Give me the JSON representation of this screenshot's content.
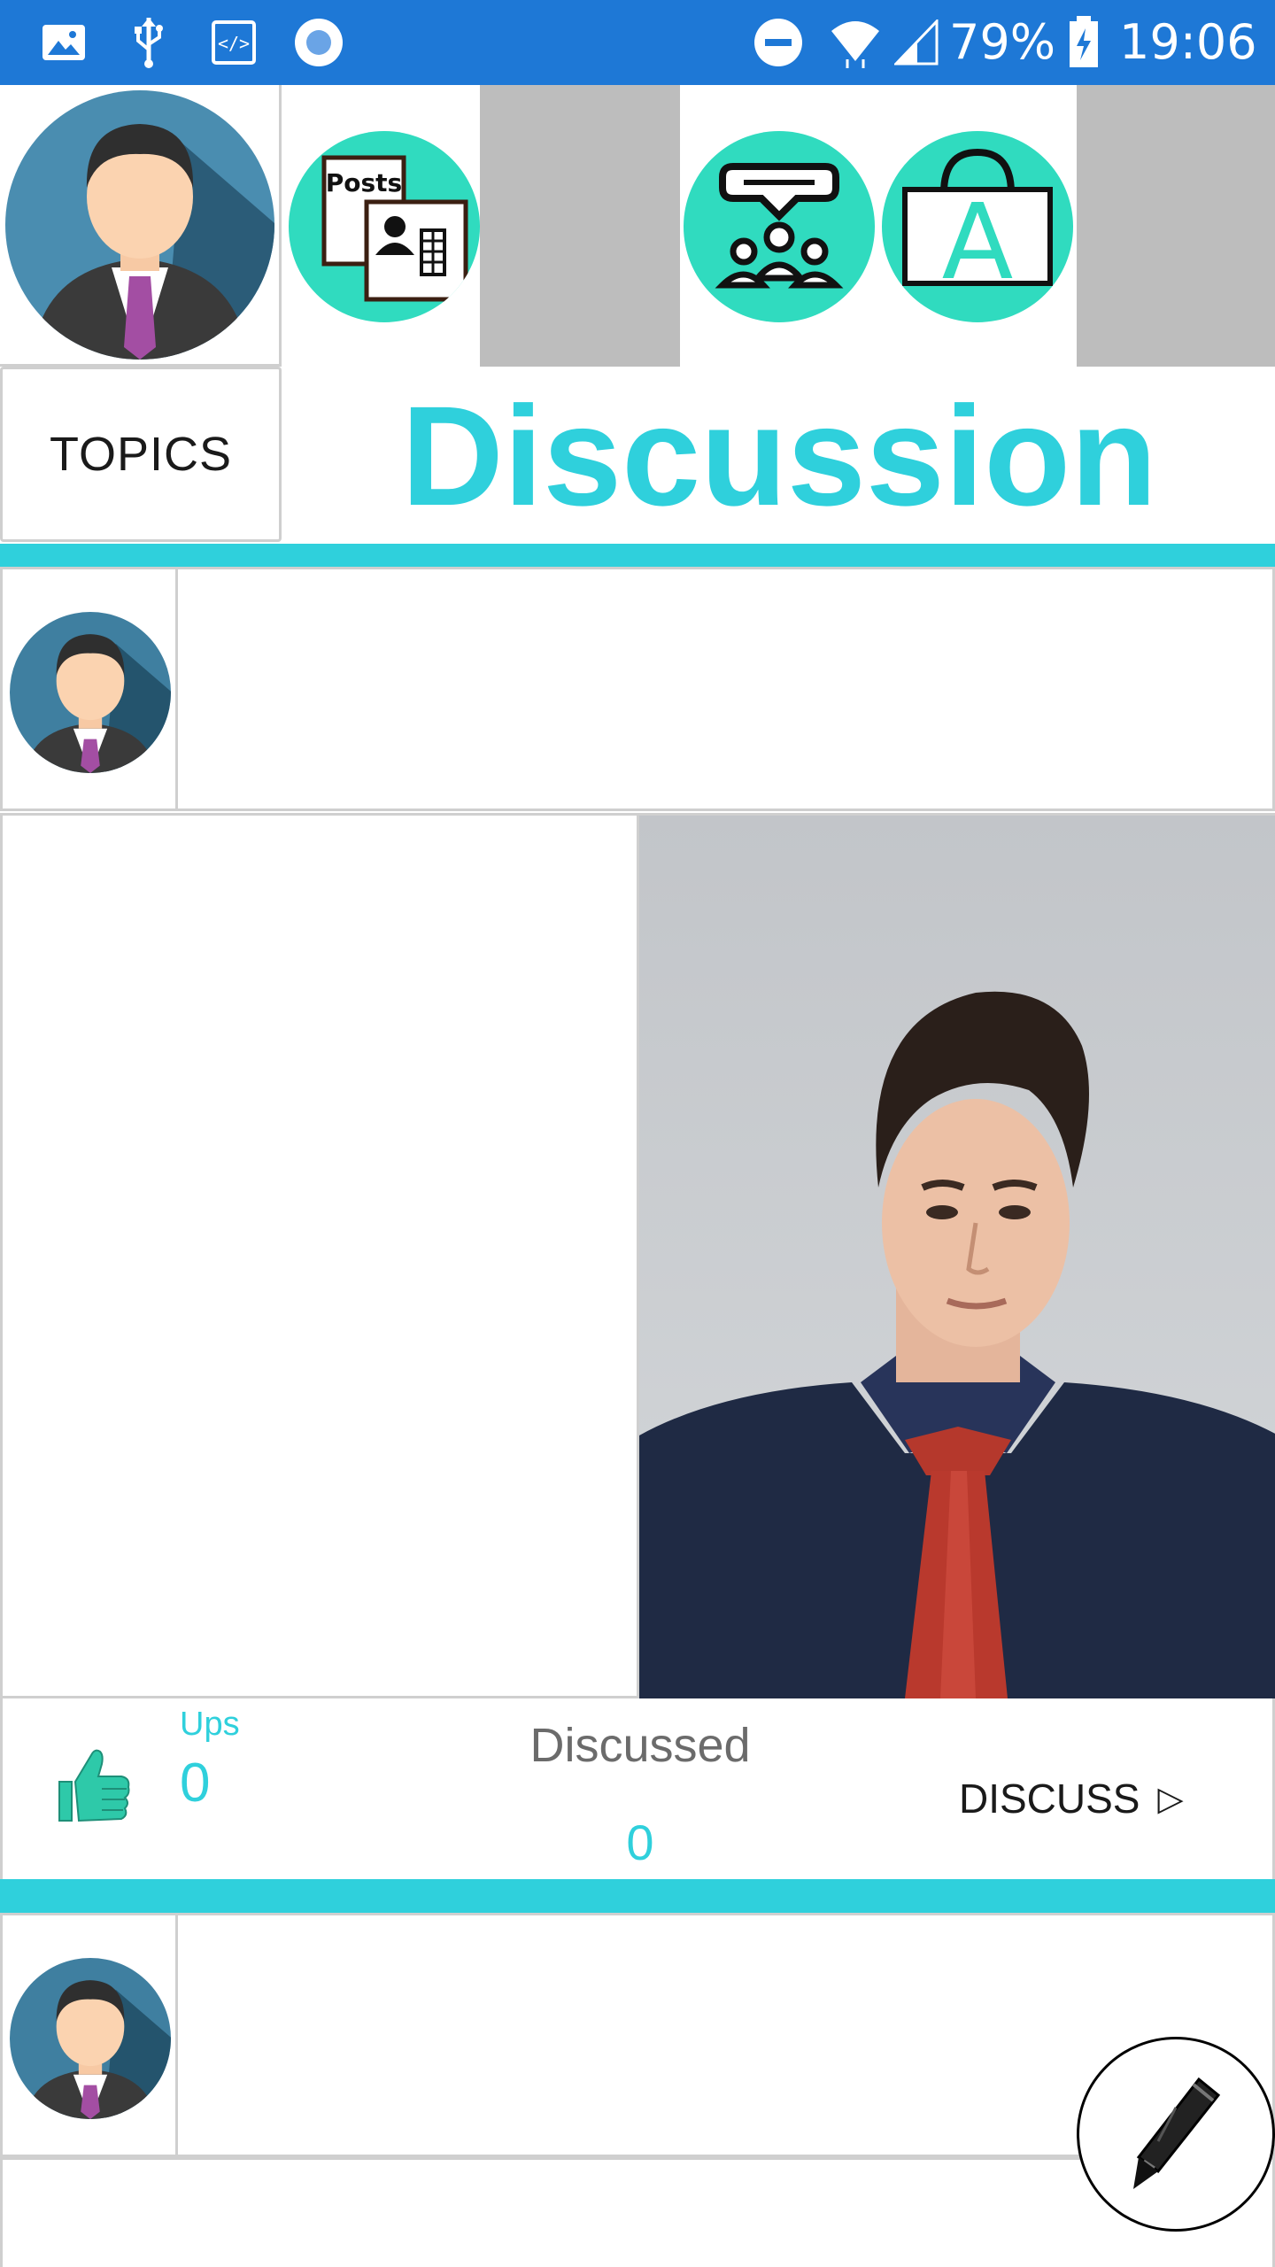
{
  "status_bar": {
    "battery": "79%",
    "time": "19:06"
  },
  "header": {
    "topics_label": "TOPICS",
    "title": "Discussion",
    "nav_icons": [
      "posts-icon",
      "group-chat-icon",
      "learning-board-icon"
    ],
    "posts_icon_text": "Posts",
    "board_icon_text": "A"
  },
  "post": {
    "ups_label": "Ups",
    "ups_count": "0",
    "discussed_label": "Discussed",
    "discussed_count": "0",
    "discuss_label": "DISCUSS",
    "discuss_arrow": "▷"
  },
  "colors": {
    "status_bar": "#1e78d6",
    "accent": "#2fd0dc",
    "nav_circle": "#30dbbf",
    "thumb": "#2ec9a9"
  }
}
